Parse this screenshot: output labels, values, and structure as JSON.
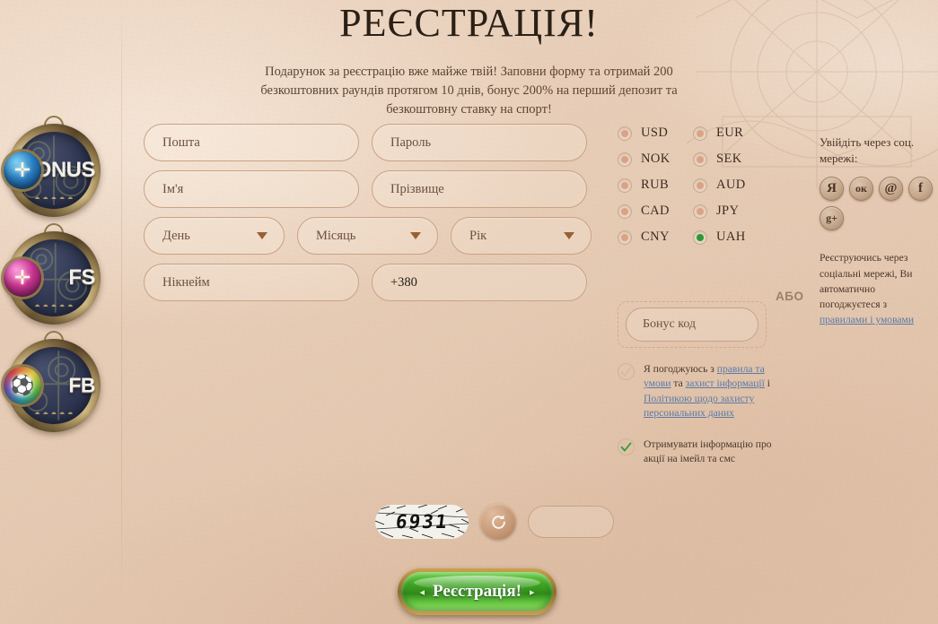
{
  "page": {
    "title": "РЕЄСТРАЦІЯ!",
    "subtitle": "Подарунок за реєстрацію вже майже твій! Заповни форму та отримай 200 безкоштовних раундів протягом 10 днів, бонус 200% на перший депозит та безкоштовну ставку на спорт!"
  },
  "medallions": [
    {
      "label": "BONUS",
      "gem_glyph": "✛",
      "name": "bonus"
    },
    {
      "label": "FS",
      "gem_glyph": "✛",
      "name": "free-spins"
    },
    {
      "label": "FB",
      "gem_glyph": "⚽",
      "name": "free-bet"
    }
  ],
  "form": {
    "email_placeholder": "Пошта",
    "password_placeholder": "Пароль",
    "firstname_placeholder": "Ім'я",
    "lastname_placeholder": "Прізвище",
    "day_placeholder": "День",
    "month_placeholder": "Місяць",
    "year_placeholder": "Рік",
    "nickname_placeholder": "Нікнейм",
    "phone_value": "+380",
    "bonus_code_placeholder": "Бонус код"
  },
  "currencies": {
    "selected": "UAH",
    "rows": [
      [
        {
          "code": "USD"
        },
        {
          "code": "EUR"
        }
      ],
      [
        {
          "code": "NOK"
        },
        {
          "code": "SEK"
        }
      ],
      [
        {
          "code": "RUB"
        },
        {
          "code": "AUD"
        }
      ],
      [
        {
          "code": "CAD"
        },
        {
          "code": "JPY"
        }
      ],
      [
        {
          "code": "CNY"
        },
        {
          "code": "UAH"
        }
      ]
    ]
  },
  "divider": {
    "or_label": "АБО"
  },
  "agreements": [
    {
      "checked": false,
      "segments": [
        {
          "text": "Я погоджуюсь з ",
          "link": false
        },
        {
          "text": "правила та умови",
          "link": true
        },
        {
          "text": " та ",
          "link": false
        },
        {
          "text": "захист інформації",
          "link": true
        },
        {
          "text": " і ",
          "link": false
        },
        {
          "text": "Політикою щодо захисту персональних даних",
          "link": true
        }
      ]
    },
    {
      "checked": true,
      "segments": [
        {
          "text": "Отримувати інформацію про акції на імейл та смс",
          "link": false
        }
      ]
    }
  ],
  "social": {
    "heading": "Увійдіть через соц. мережі:",
    "icons": [
      {
        "glyph": "Я",
        "name": "yandex"
      },
      {
        "glyph": "ок",
        "name": "odnoklassniki"
      },
      {
        "glyph": "@",
        "name": "mailru"
      },
      {
        "glyph": "f",
        "name": "facebook"
      },
      {
        "glyph": "g+",
        "name": "googleplus"
      }
    ],
    "note_prefix": "Реєструючись через соціальні мережі, Ви автоматично погоджуєтеся з ",
    "note_link": "правилами і умовами"
  },
  "captcha": {
    "code": "6931",
    "input_value": ""
  },
  "submit": {
    "label": "Реєстрація!",
    "arrow_left": "◂",
    "arrow_right": "▸"
  },
  "colors": {
    "background": "#e6cbb5",
    "border": "#c8a284",
    "text": "#4a3729",
    "link": "#5a7aa8",
    "selected_radio": "#2a9a33",
    "check_green": "#2fa13a",
    "submit_green": "#3fa524",
    "gold": "#c8a04c"
  }
}
